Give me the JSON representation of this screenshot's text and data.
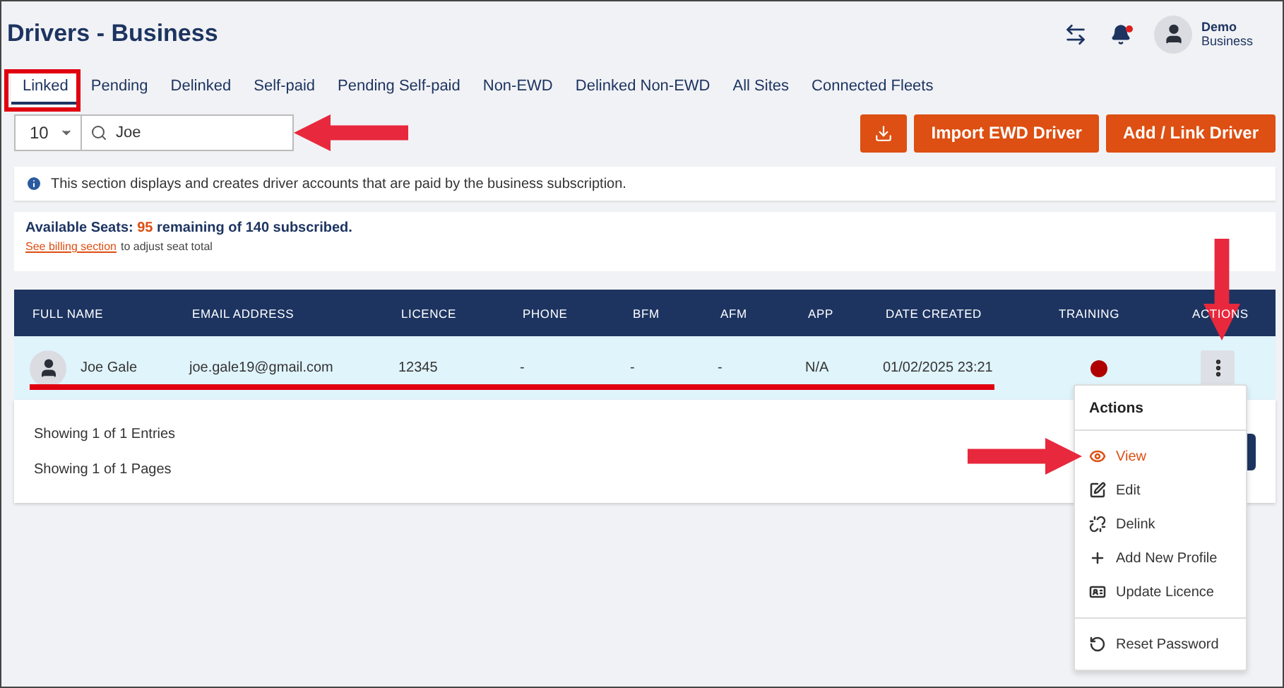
{
  "title": "Drivers - Business",
  "user": {
    "name": "Demo",
    "role": "Business"
  },
  "tabs": [
    {
      "label": "Linked",
      "selected": true
    },
    {
      "label": "Pending",
      "selected": false
    },
    {
      "label": "Delinked",
      "selected": false
    },
    {
      "label": "Self-paid",
      "selected": false
    },
    {
      "label": "Pending Self-paid",
      "selected": false
    },
    {
      "label": "Non-EWD",
      "selected": false
    },
    {
      "label": "Delinked Non-EWD",
      "selected": false
    },
    {
      "label": "All Sites",
      "selected": false
    },
    {
      "label": "Connected Fleets",
      "selected": false
    }
  ],
  "page_size": "10",
  "search": {
    "value": "Joe"
  },
  "buttons": [
    "Import EWD Driver",
    "Add / Link Driver"
  ],
  "info": "This section displays and creates driver accounts that are paid by the business subscription.",
  "seats": {
    "label": "Available Seats:",
    "count": "95",
    "rest": "remaining of 140 subscribed.",
    "link": "See billing section",
    "note": "to adjust seat total"
  },
  "table": {
    "columns": [
      "FULL NAME",
      "EMAIL ADDRESS",
      "LICENCE",
      "PHONE",
      "BFM",
      "AFM",
      "APP",
      "DATE CREATED",
      "TRAINING",
      "ACTIONS"
    ],
    "rows": [
      {
        "cells": [
          "Joe Gale",
          "joe.gale19@gmail.com",
          "12345",
          "-",
          "-",
          "-",
          "N/A",
          "01/02/2025 23:21"
        ],
        "color": "#b00000"
      }
    ]
  },
  "footer": [
    "Showing 1 of 1 Entries",
    "Showing 1 of 1 Pages"
  ],
  "menu": {
    "title": "Actions",
    "groups": [
      [
        {
          "label": "View",
          "selected": true
        },
        {
          "label": "Edit",
          "selected": false
        },
        {
          "label": "Delink",
          "selected": false
        },
        {
          "label": "Add New Profile",
          "selected": false
        },
        {
          "label": "Update Licence",
          "selected": false
        }
      ],
      [
        {
          "label": "Reset Password",
          "selected": false
        }
      ]
    ]
  }
}
